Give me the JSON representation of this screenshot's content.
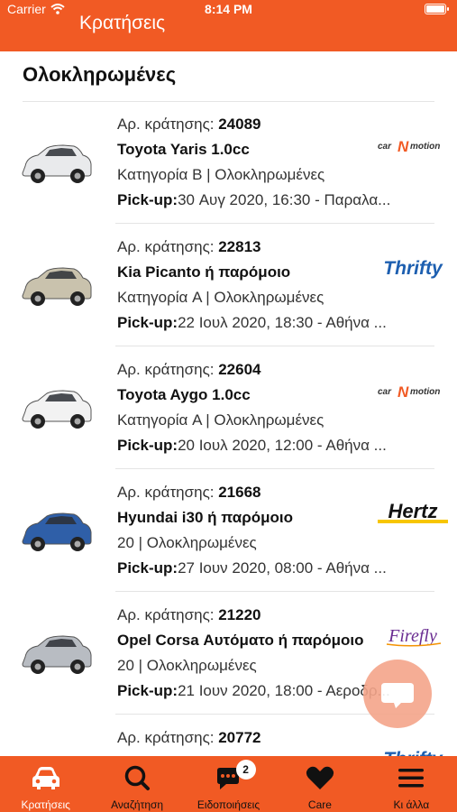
{
  "status_bar": {
    "carrier": "Carrier",
    "time": "8:14 PM"
  },
  "header": {
    "title": "Κρατήσεις"
  },
  "section": {
    "title": "Ολοκληρωμένες"
  },
  "bookings": [
    {
      "number_label": "Αρ. κράτησης: ",
      "number": "24089",
      "car": "Toyota Yaris 1.0cc",
      "details": "Κατηγορία B | Ολοκληρωμένες",
      "pickup_label": "Pick-up:",
      "pickup": "30 Αυγ 2020, 16:30 - Παραλα...",
      "company": "car N motion",
      "car_color": "#e9eaec"
    },
    {
      "number_label": "Αρ. κράτησης: ",
      "number": "22813",
      "car": "Kia Picanto ή παρόμοιο",
      "details": "Κατηγορία A | Ολοκληρωμένες",
      "pickup_label": "Pick-up:",
      "pickup": "22 Ιουλ 2020, 18:30 - Αθήνα ...",
      "company": "Thrifty",
      "car_color": "#c9c2ad"
    },
    {
      "number_label": "Αρ. κράτησης: ",
      "number": "22604",
      "car": "Toyota Aygo 1.0cc",
      "details": "Κατηγορία A | Ολοκληρωμένες",
      "pickup_label": "Pick-up:",
      "pickup": "20 Ιουλ 2020, 12:00 - Αθήνα ...",
      "company": "car N motion",
      "car_color": "#f2f2f2"
    },
    {
      "number_label": "Αρ. κράτησης: ",
      "number": "21668",
      "car": "Hyundai i30 ή παρόμοιο",
      "details": "20 | Ολοκληρωμένες",
      "pickup_label": "Pick-up:",
      "pickup": "27 Ιουν 2020, 08:00 - Αθήνα ...",
      "company": "Hertz",
      "car_color": "#2f5fa8"
    },
    {
      "number_label": "Αρ. κράτησης: ",
      "number": "21220",
      "car": "Opel Corsa Αυτόματο ή παρόμοιο",
      "details": "20 | Ολοκληρωμένες",
      "pickup_label": "Pick-up:",
      "pickup": "21 Ιουν 2020, 18:00 - Αεροδρ...",
      "company": "Firefly",
      "car_color": "#b8bcc2"
    },
    {
      "number_label": "Αρ. κράτησης: ",
      "number": "20772",
      "car": "",
      "details": "",
      "pickup_label": "",
      "pickup": "",
      "company": "Thrifty",
      "car_color": "#c9c2ad"
    }
  ],
  "tabs": [
    {
      "label": "Κρατήσεις",
      "icon": "car-icon"
    },
    {
      "label": "Αναζήτηση",
      "icon": "search-icon"
    },
    {
      "label": "Ειδοποιήσεις",
      "icon": "chat-icon",
      "badge": "2"
    },
    {
      "label": "Care",
      "icon": "heart-icon"
    },
    {
      "label": "Κι άλλα",
      "icon": "menu-icon"
    }
  ],
  "colors": {
    "brand": "#f15a24",
    "divider": "#e4e4e4"
  }
}
